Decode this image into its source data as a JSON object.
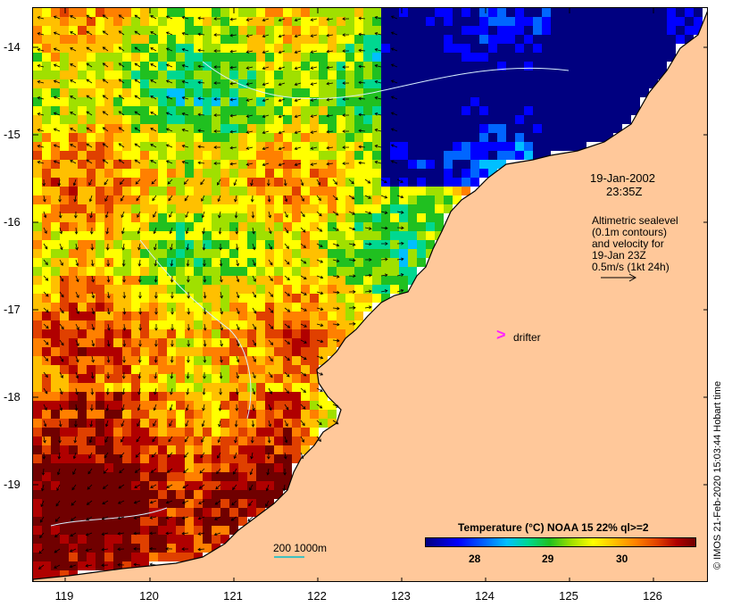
{
  "map": {
    "lat_labels": [
      "-14",
      "-15",
      "-16",
      "-17",
      "-18",
      "-19"
    ],
    "lon_labels": [
      "119",
      "120",
      "121",
      "122",
      "123",
      "124",
      "125",
      "126"
    ],
    "land_color": "#ffc89a",
    "coast_color": "#000000",
    "contour_color": "#d8f0ff",
    "arrow_color": "#000000"
  },
  "annotations": {
    "date": "19-Jan-2002",
    "time": "23:35Z",
    "altimetric_lines": [
      "Altimetric sealevel",
      "(0.1m contours)",
      "and velocity for",
      "19-Jan 23Z",
      "0.5m/s (1kt 24h)"
    ],
    "drifter_symbol": ">",
    "drifter_label": "drifter",
    "drifter_color": "#ff22ff"
  },
  "legend": {
    "title": "Temperature (°C) NOAA 15 22% ql>=2",
    "ticks": [
      "28",
      "29",
      "30"
    ]
  },
  "scale": {
    "label": "200  1000m"
  },
  "credit": "© IMOS 21-Feb-2020 15:03:44 Hobart time"
}
